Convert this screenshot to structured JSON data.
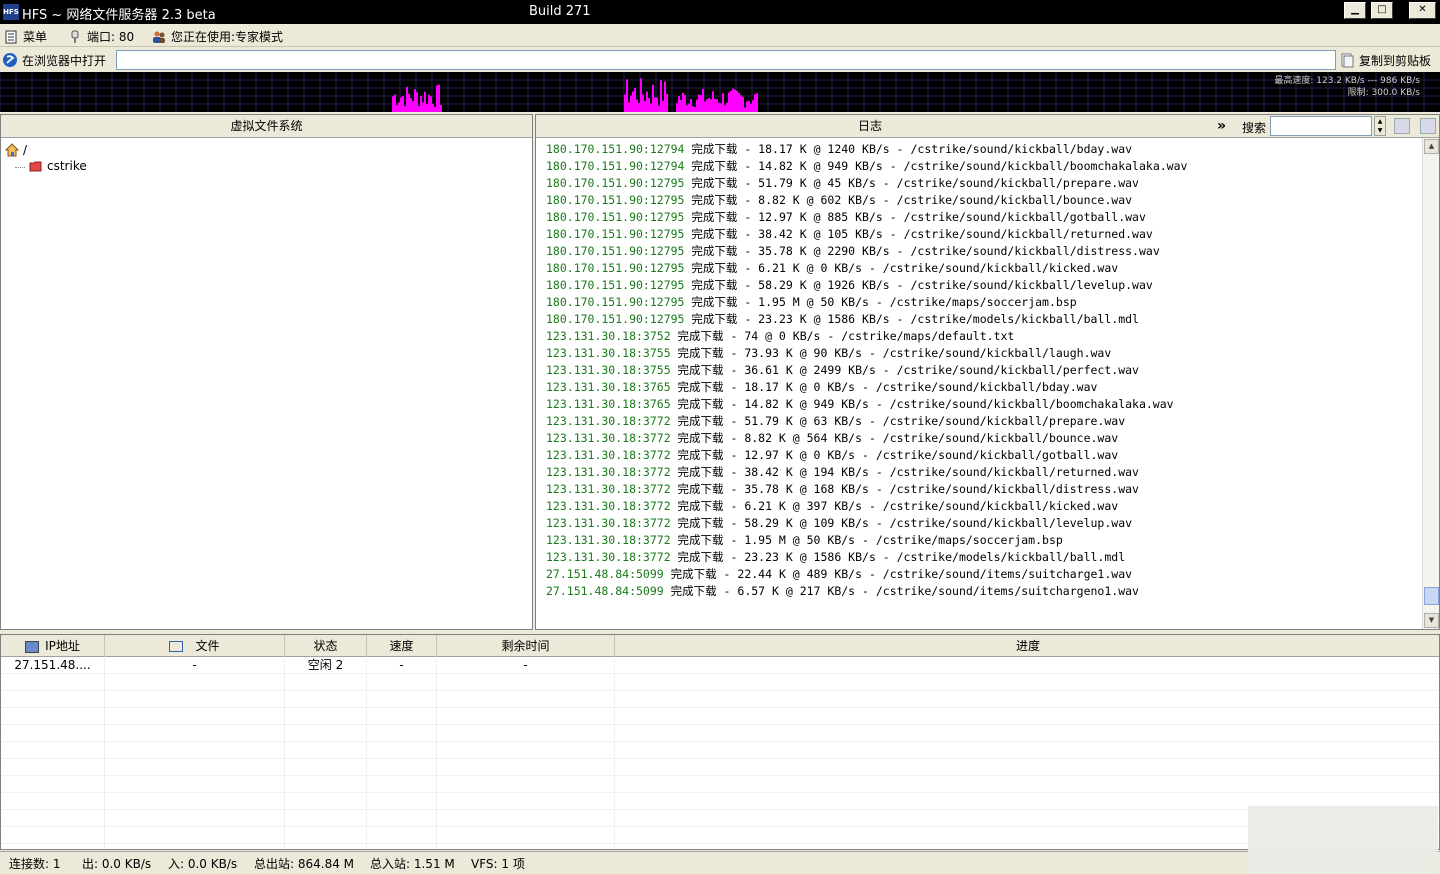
{
  "window": {
    "title": "HFS ~ 网络文件服务器 2.3 beta",
    "build": "Build 271",
    "icon_text": "HFS",
    "minimize": "▁",
    "maximize": "□",
    "close": "✕"
  },
  "menubar": {
    "menu_label": "菜单",
    "port_label": "端口: 80",
    "mode_label": "您正在使用:专家模式"
  },
  "urlbar": {
    "open_in_browser": "在浏览器中打开",
    "url_value": "",
    "copy_to_clipboard": "复制到剪贴板"
  },
  "graph": {
    "top_speed": "最高速度: 123.2 KB/s --- 986 KB/s",
    "limit": "限制: 300.0 KB/s",
    "bar_color": "#ff00ff"
  },
  "vfs": {
    "header": "虚拟文件系统",
    "root": "/",
    "folder": "cstrike"
  },
  "log": {
    "header": "日志",
    "expand_icon": "»",
    "search_label": "搜索",
    "search_value": "",
    "lines": [
      {
        "ip": "180.170.151.90:12794",
        "text": " 完成下载 - 18.17 K @ 1240 KB/s - /cstrike/sound/kickball/bday.wav"
      },
      {
        "ip": "180.170.151.90:12794",
        "text": " 完成下载 - 14.82 K @ 949 KB/s - /cstrike/sound/kickball/boomchakalaka.wav"
      },
      {
        "ip": "180.170.151.90:12795",
        "text": " 完成下载 - 51.79 K @ 45 KB/s - /cstrike/sound/kickball/prepare.wav"
      },
      {
        "ip": "180.170.151.90:12795",
        "text": " 完成下载 - 8.82 K @ 602 KB/s - /cstrike/sound/kickball/bounce.wav"
      },
      {
        "ip": "180.170.151.90:12795",
        "text": " 完成下载 - 12.97 K @ 885 KB/s - /cstrike/sound/kickball/gotball.wav"
      },
      {
        "ip": "180.170.151.90:12795",
        "text": " 完成下载 - 38.42 K @ 105 KB/s - /cstrike/sound/kickball/returned.wav"
      },
      {
        "ip": "180.170.151.90:12795",
        "text": " 完成下载 - 35.78 K @ 2290 KB/s - /cstrike/sound/kickball/distress.wav"
      },
      {
        "ip": "180.170.151.90:12795",
        "text": " 完成下载 - 6.21 K @ 0 KB/s - /cstrike/sound/kickball/kicked.wav"
      },
      {
        "ip": "180.170.151.90:12795",
        "text": " 完成下载 - 58.29 K @ 1926 KB/s - /cstrike/sound/kickball/levelup.wav"
      },
      {
        "ip": "180.170.151.90:12795",
        "text": " 完成下载 - 1.95 M @ 50 KB/s - /cstrike/maps/soccerjam.bsp"
      },
      {
        "ip": "180.170.151.90:12795",
        "text": " 完成下载 - 23.23 K @ 1586 KB/s - /cstrike/models/kickball/ball.mdl"
      },
      {
        "ip": "123.131.30.18:3752",
        "text": " 完成下载 - 74 @ 0 KB/s - /cstrike/maps/default.txt"
      },
      {
        "ip": "123.131.30.18:3755",
        "text": " 完成下载 - 73.93 K @ 90 KB/s - /cstrike/sound/kickball/laugh.wav"
      },
      {
        "ip": "123.131.30.18:3755",
        "text": " 完成下载 - 36.61 K @ 2499 KB/s - /cstrike/sound/kickball/perfect.wav"
      },
      {
        "ip": "123.131.30.18:3765",
        "text": " 完成下载 - 18.17 K @ 0 KB/s - /cstrike/sound/kickball/bday.wav"
      },
      {
        "ip": "123.131.30.18:3765",
        "text": " 完成下载 - 14.82 K @ 949 KB/s - /cstrike/sound/kickball/boomchakalaka.wav"
      },
      {
        "ip": "123.131.30.18:3772",
        "text": " 完成下载 - 51.79 K @ 63 KB/s - /cstrike/sound/kickball/prepare.wav"
      },
      {
        "ip": "123.131.30.18:3772",
        "text": " 完成下载 - 8.82 K @ 564 KB/s - /cstrike/sound/kickball/bounce.wav"
      },
      {
        "ip": "123.131.30.18:3772",
        "text": " 完成下载 - 12.97 K @ 0 KB/s - /cstrike/sound/kickball/gotball.wav"
      },
      {
        "ip": "123.131.30.18:3772",
        "text": " 完成下载 - 38.42 K @ 194 KB/s - /cstrike/sound/kickball/returned.wav"
      },
      {
        "ip": "123.131.30.18:3772",
        "text": " 完成下载 - 35.78 K @ 168 KB/s - /cstrike/sound/kickball/distress.wav"
      },
      {
        "ip": "123.131.30.18:3772",
        "text": " 完成下载 - 6.21 K @ 397 KB/s - /cstrike/sound/kickball/kicked.wav"
      },
      {
        "ip": "123.131.30.18:3772",
        "text": " 完成下载 - 58.29 K @ 109 KB/s - /cstrike/sound/kickball/levelup.wav"
      },
      {
        "ip": "123.131.30.18:3772",
        "text": " 完成下载 - 1.95 M @ 50 KB/s - /cstrike/maps/soccerjam.bsp"
      },
      {
        "ip": "123.131.30.18:3772",
        "text": " 完成下载 - 23.23 K @ 1586 KB/s - /cstrike/models/kickball/ball.mdl"
      },
      {
        "ip": "27.151.48.84:5099",
        "text": " 完成下载 - 22.44 K @ 489 KB/s - /cstrike/sound/items/suitcharge1.wav"
      },
      {
        "ip": "27.151.48.84:5099",
        "text": " 完成下载 - 6.57 K @ 217 KB/s - /cstrike/sound/items/suitchargeno1.wav"
      }
    ]
  },
  "connections": {
    "columns": [
      "IP地址",
      "文件",
      "状态",
      "速度",
      "剩余时间",
      "进度"
    ],
    "rows": [
      {
        "ip": "27.151.48....",
        "file": "-",
        "status": "空闲 2",
        "speed": "-",
        "remaining": "-",
        "progress": ""
      }
    ]
  },
  "statusbar": {
    "connections": "连接数: 1",
    "out_speed": "出: 0.0 KB/s",
    "in_speed": "入: 0.0 KB/s",
    "total_out": "总出站: 864.84 M",
    "total_in": "总入站: 1.51 M",
    "vfs_count": "VFS: 1 项"
  }
}
